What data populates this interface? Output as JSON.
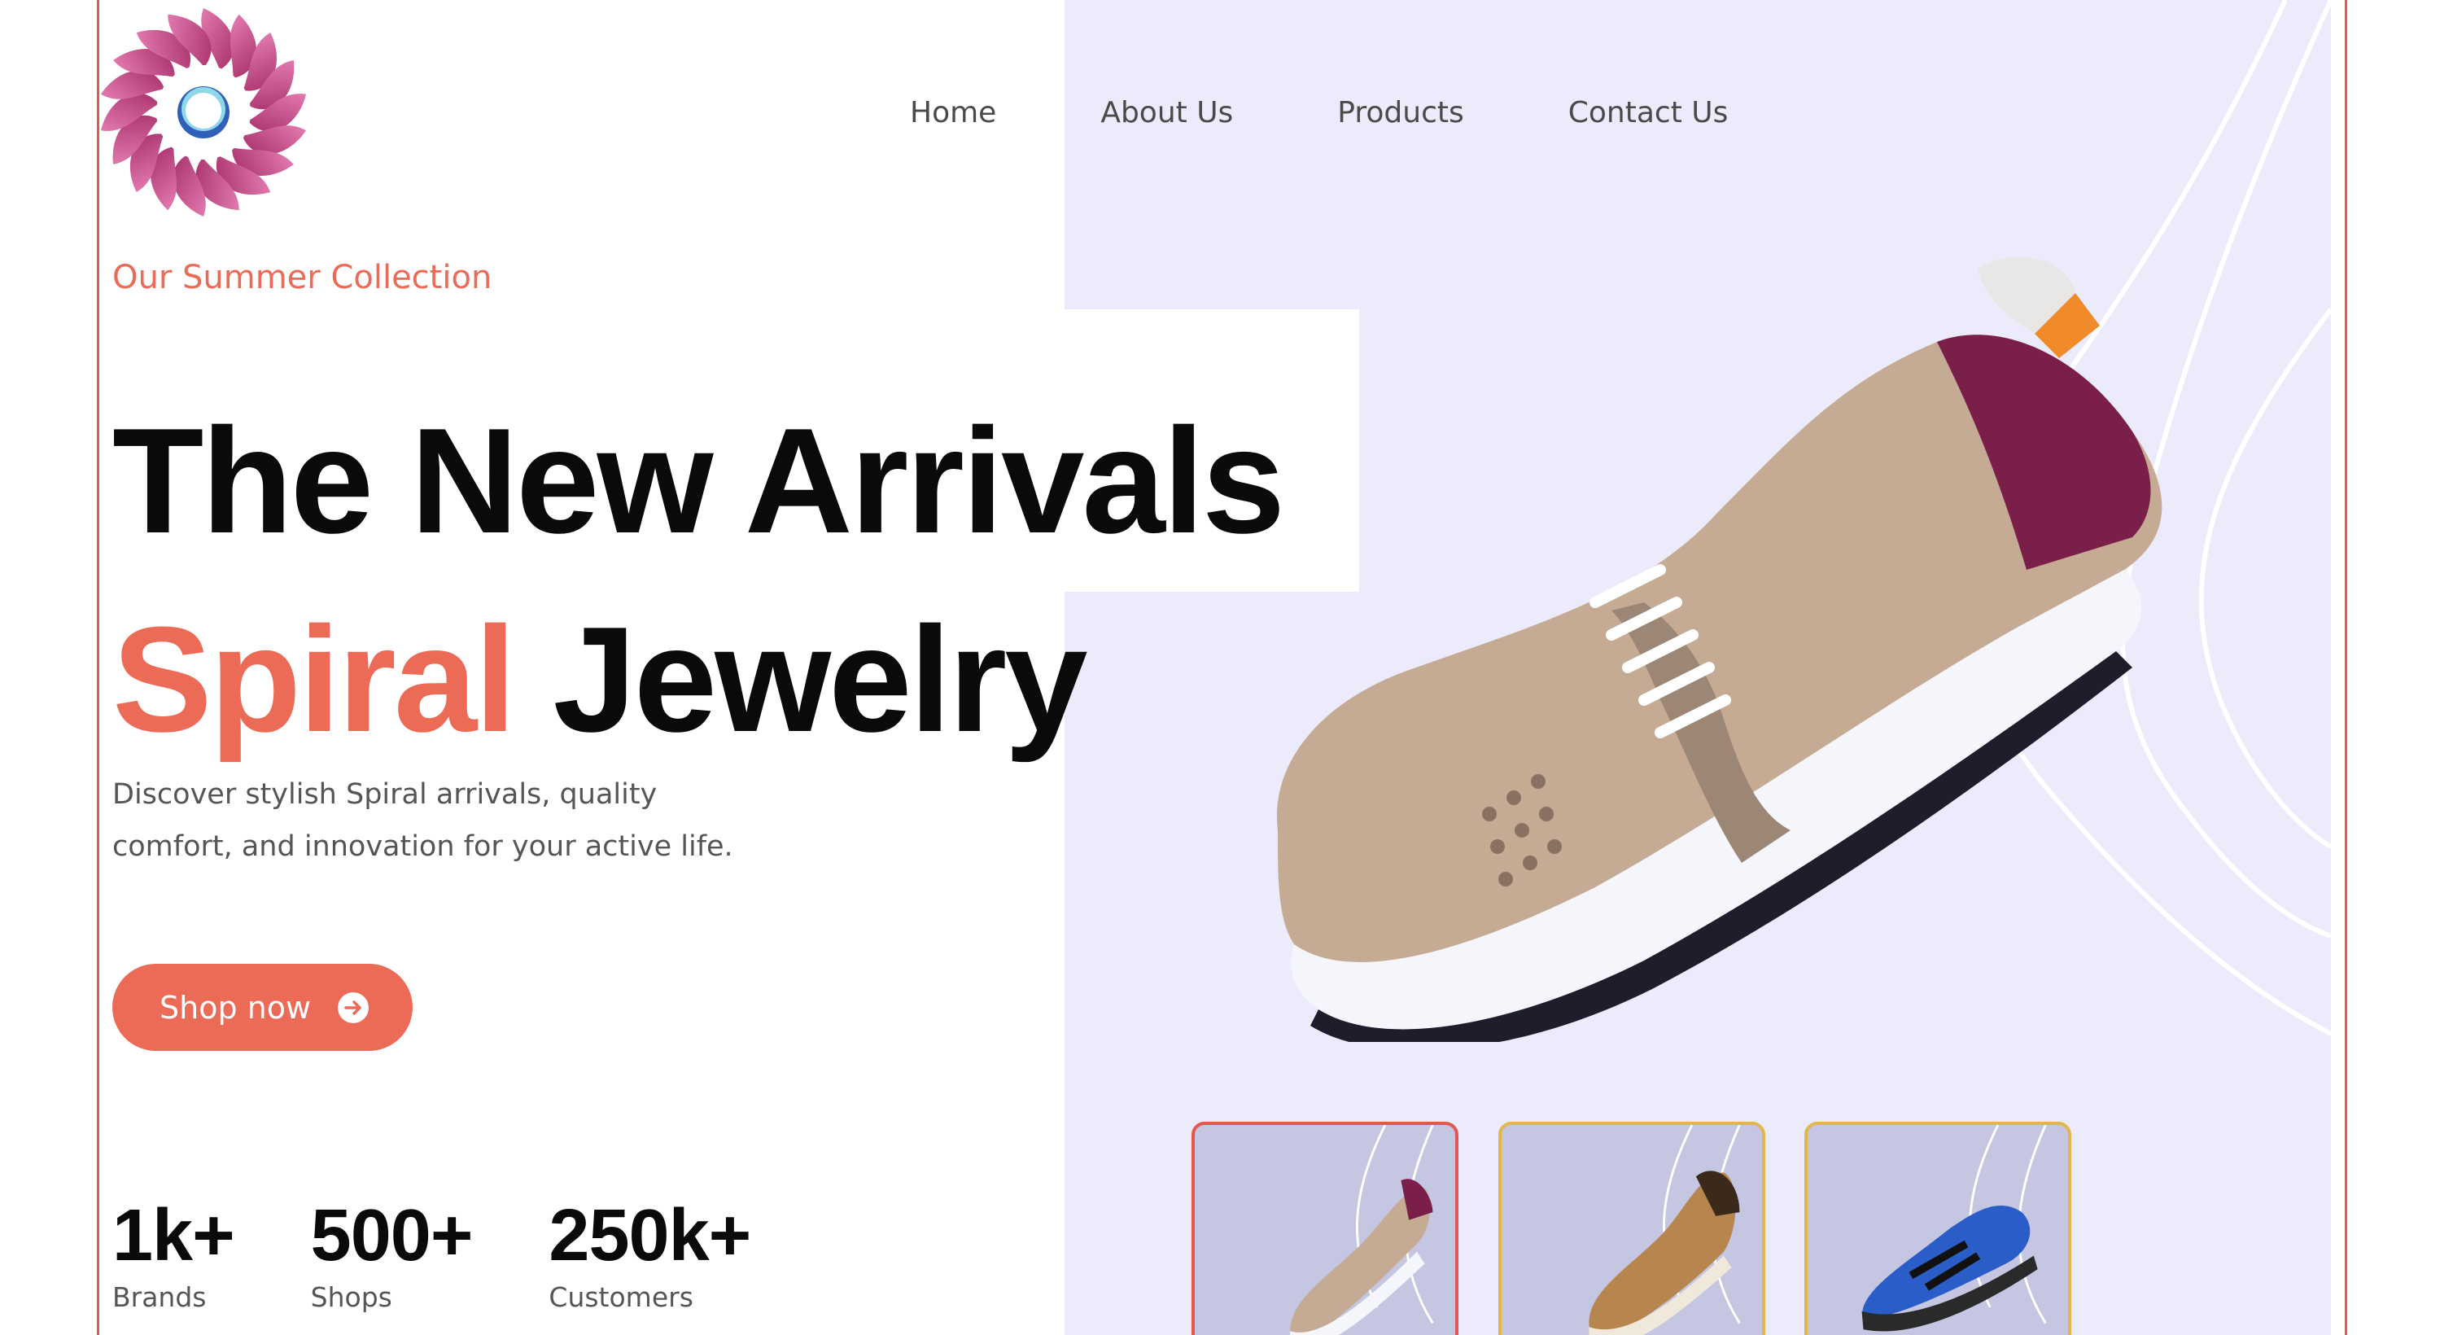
{
  "brand": {
    "logo_icon": "spiral-logo-icon",
    "colors": {
      "accent": "#ec6b57",
      "frame": "#e4574c",
      "panel": "#ebebfb",
      "text": "#0a0a0a"
    }
  },
  "nav": {
    "items": [
      {
        "label": "Home"
      },
      {
        "label": "About Us"
      },
      {
        "label": "Products"
      },
      {
        "label": "Contact Us"
      }
    ]
  },
  "hero": {
    "kicker": "Our Summer Collection",
    "title_line1": "The New Arrivals",
    "title_accent": "Spiral",
    "title_rest": "Jewelry",
    "description": "Discover stylish Spiral arrivals, quality comfort, and innovation for your active life.",
    "cta_label": "Shop now",
    "cta_icon": "arrow-right-circle-icon"
  },
  "stats": [
    {
      "value": "1k+",
      "label": "Brands"
    },
    {
      "value": "500+",
      "label": "Shops"
    },
    {
      "value": "250k+",
      "label": "Customers"
    }
  ],
  "thumbnails": [
    {
      "name": "beige-running-shoe",
      "selected": true
    },
    {
      "name": "brown-leather-sneaker",
      "selected": false
    },
    {
      "name": "blue-trail-shoe",
      "selected": false
    }
  ]
}
